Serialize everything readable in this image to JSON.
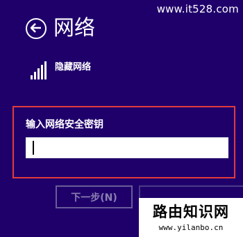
{
  "watermark_top": "www.it528.com",
  "header": {
    "title": "网络"
  },
  "network": {
    "name": "隐藏网络",
    "signal_bars": 5
  },
  "key_entry": {
    "label": "输入网络安全密钥",
    "value": ""
  },
  "buttons": {
    "next_label": "下一步(N)"
  },
  "watermark_bottom": {
    "title": "路由知识网",
    "url": "www.yilanbo.cn"
  },
  "colors": {
    "background": "#1f006b",
    "highlight_border": "#e23b3b"
  },
  "icons": {
    "back": "back-arrow-icon",
    "signal": "signal-strength-icon"
  }
}
